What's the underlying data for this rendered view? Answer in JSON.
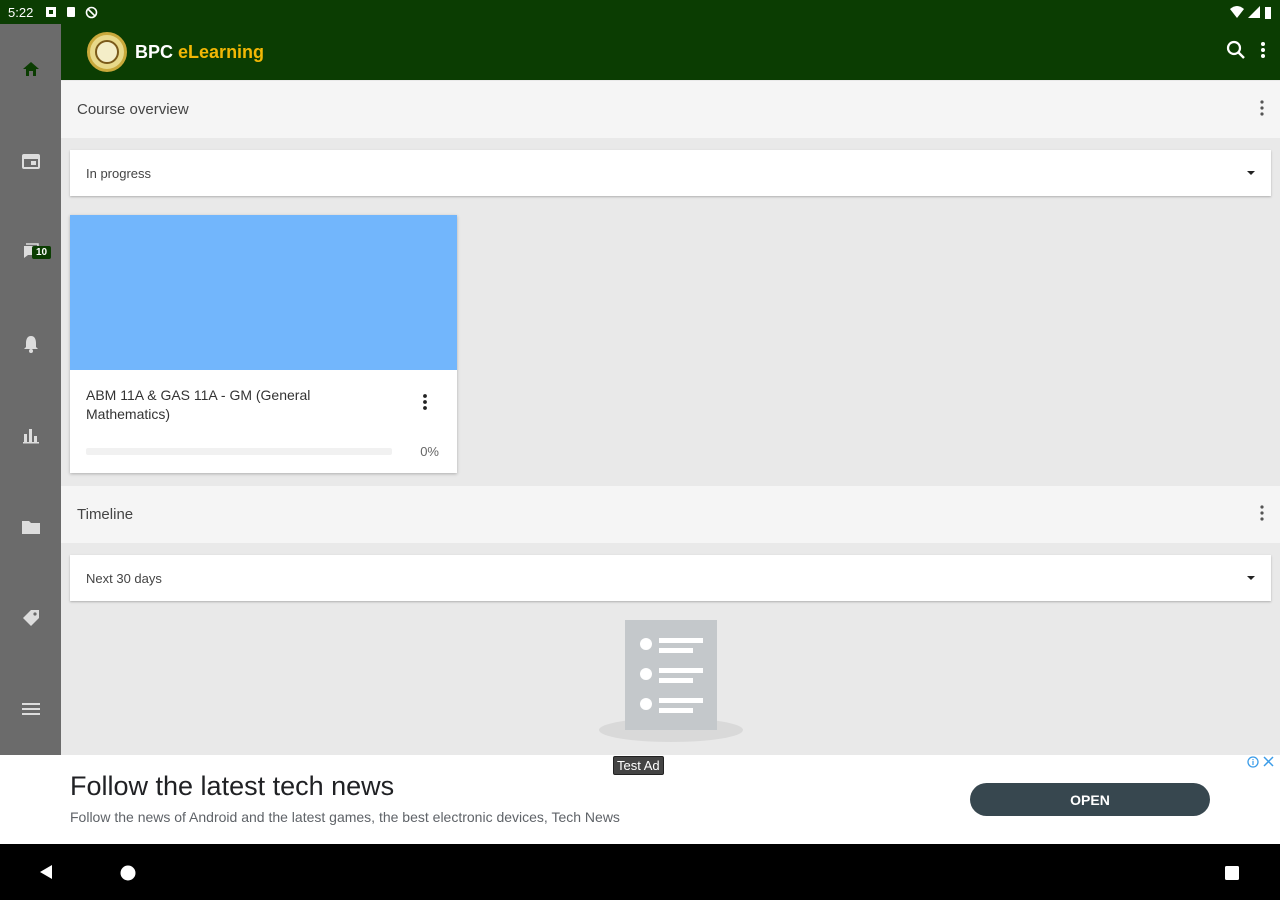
{
  "status_bar": {
    "time": "5:22"
  },
  "app": {
    "brand_part1": "BPC",
    "brand_part2": "eLearning"
  },
  "sidebar": {
    "items": [
      {
        "name": "home"
      },
      {
        "name": "calendar"
      },
      {
        "name": "messages",
        "badge": "10"
      },
      {
        "name": "notifications"
      },
      {
        "name": "grades"
      },
      {
        "name": "files"
      },
      {
        "name": "tags"
      },
      {
        "name": "more"
      }
    ]
  },
  "course_overview": {
    "title": "Course overview",
    "filter": "In progress",
    "courses": [
      {
        "name": "ABM 11A & GAS 11A - GM (General Mathematics)",
        "progress_label": "0%",
        "progress": 0,
        "image_color": "#72b6fc"
      }
    ]
  },
  "timeline": {
    "title": "Timeline",
    "filter": "Next 30 days"
  },
  "ad": {
    "tag": "Test Ad",
    "headline": "Follow the latest tech news",
    "body": "Follow the news of Android and the latest games, the best electronic devices, Tech News",
    "cta": "OPEN"
  },
  "colors": {
    "brand_green": "#0b3d02",
    "brand_yellow": "#f2b705",
    "sidebar_gray": "#6b6b6b"
  }
}
